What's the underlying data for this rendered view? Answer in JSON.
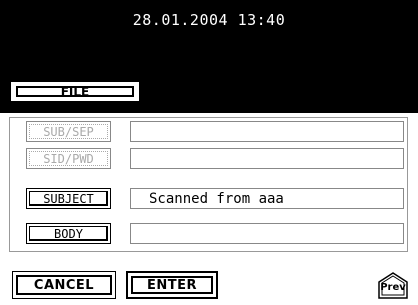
{
  "header": {
    "datetime": "28.01.2004 13:40"
  },
  "tabs": {
    "file_label": "FILE"
  },
  "fields": [
    {
      "label": "SUB/SEP",
      "value": "",
      "enabled": false
    },
    {
      "label": "SID/PWD",
      "value": "",
      "enabled": false
    },
    {
      "label": "SUBJECT",
      "value": "Scanned from aaa",
      "enabled": true
    },
    {
      "label": "BODY",
      "value": "",
      "enabled": true
    }
  ],
  "footer": {
    "cancel_label": "CANCEL",
    "enter_label": "ENTER",
    "prev_label": "Prev"
  },
  "colors": {
    "top_bar": "#000000",
    "panel": "#ffffff",
    "disabled_text": "#aaaaaa"
  }
}
